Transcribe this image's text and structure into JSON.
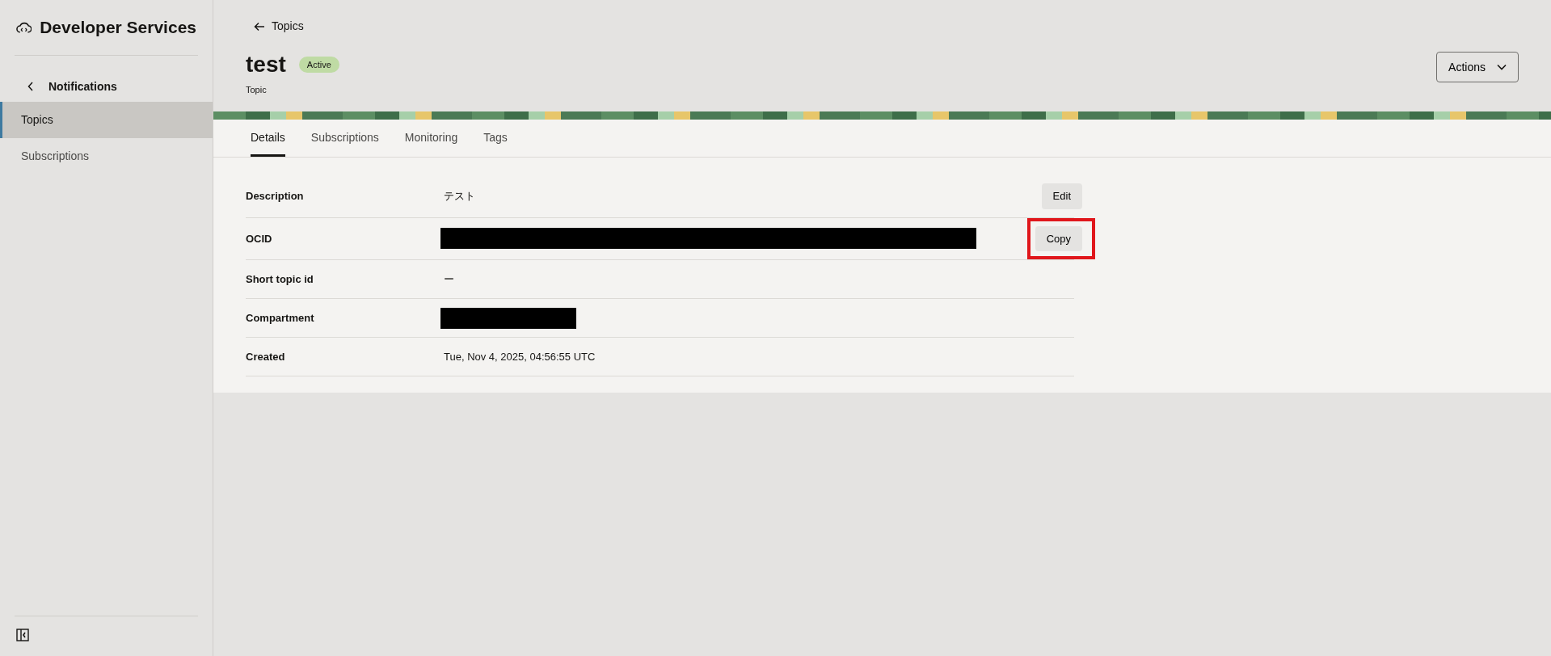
{
  "sidebar": {
    "title": "Developer Services",
    "back_label": "Notifications",
    "items": [
      {
        "label": "Topics",
        "selected": true
      },
      {
        "label": "Subscriptions",
        "selected": false
      }
    ]
  },
  "header": {
    "breadcrumb": "Topics",
    "title": "test",
    "status": "Active",
    "subtitle": "Topic",
    "actions_button": "Actions"
  },
  "tabs": [
    {
      "label": "Details",
      "selected": true
    },
    {
      "label": "Subscriptions",
      "selected": false
    },
    {
      "label": "Monitoring",
      "selected": false
    },
    {
      "label": "Tags",
      "selected": false
    }
  ],
  "details": [
    {
      "label": "Description",
      "kind": "text",
      "value": "テスト",
      "action": {
        "label": "Edit",
        "highlighted": false
      }
    },
    {
      "label": "OCID",
      "kind": "redacted",
      "action": {
        "label": "Copy",
        "highlighted": true
      }
    },
    {
      "label": "Short topic id",
      "kind": "text",
      "value": "ー"
    },
    {
      "label": "Compartment",
      "kind": "redacted"
    },
    {
      "label": "Created",
      "kind": "text",
      "value": "Tue, Nov 4, 2025, 04:56:55 UTC"
    }
  ]
}
